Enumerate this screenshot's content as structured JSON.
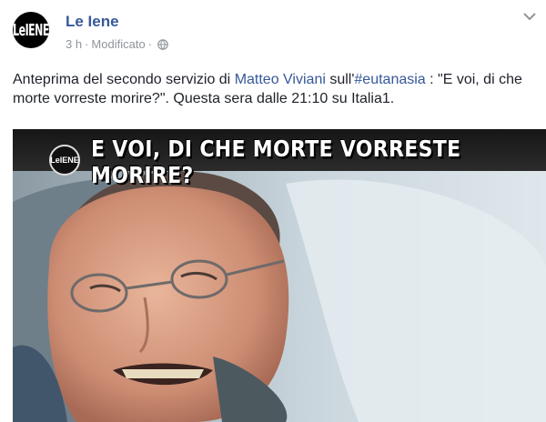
{
  "post": {
    "page_name": "Le Iene",
    "avatar_text": "LeIENE",
    "time": "3 h",
    "separator": "·",
    "edited": "Modificato",
    "message": {
      "part1": "Anteprima del secondo servizio di ",
      "mention": "Matteo Viviani",
      "part2": " sull'",
      "hashtag": "#eutanasia",
      "part3": " : \"E voi, di che morte vorreste morire?\". Questa sera dalle 21:10 su Italia1."
    },
    "photo": {
      "logo_text": "LeIENE",
      "caption": "E VOI, DI CHE MORTE VORRESTE MORIRE?"
    }
  },
  "colors": {
    "link": "#365899",
    "meta": "#90949c",
    "text": "#1d2129"
  },
  "icons": [
    "globe-icon",
    "chevron-down-icon"
  ]
}
